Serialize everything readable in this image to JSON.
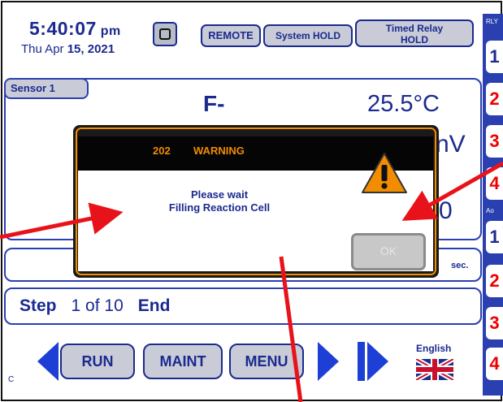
{
  "header": {
    "time": "5:40:07",
    "ampm": "pm",
    "date_prefix": "Thu  Apr ",
    "date_bold": "15, 2021",
    "remote_label": "REMOTE",
    "system_hold_label": "System HOLD",
    "timed_relay_label": "Timed Relay\nHOLD"
  },
  "relay_column": {
    "rly_label": "RLY",
    "ao_label": "Ao",
    "relays": [
      "1",
      "2",
      "3",
      "4"
    ],
    "aos": [
      "1",
      "2",
      "3",
      "4"
    ]
  },
  "sensor": {
    "tab_label": "Sensor 1",
    "ion": "F-",
    "temperature": "25.5°C",
    "mv_fragment": "nV",
    "value_fragment": "0"
  },
  "middle_bar": {
    "sec_label": "sec."
  },
  "step": {
    "label": "Step",
    "current": "1",
    "of": "of",
    "total": "10",
    "end": "End"
  },
  "bottom": {
    "run_label": "RUN",
    "maint_label": "MAINT",
    "menu_label": "MENU",
    "language": "English",
    "corner_label": "C"
  },
  "dialog": {
    "code": "202",
    "title": "WARNING",
    "message_line1": "Please wait",
    "message_line2": "Filling Reaction Cell",
    "ok_label": "OK",
    "ok_enabled": false
  },
  "colors": {
    "primary_blue": "#1b2a8f",
    "relay_blue": "#2a3fb0",
    "warning_orange": "#f28c00",
    "relay_red": "#e00000",
    "annotation_red": "#e8131a"
  }
}
